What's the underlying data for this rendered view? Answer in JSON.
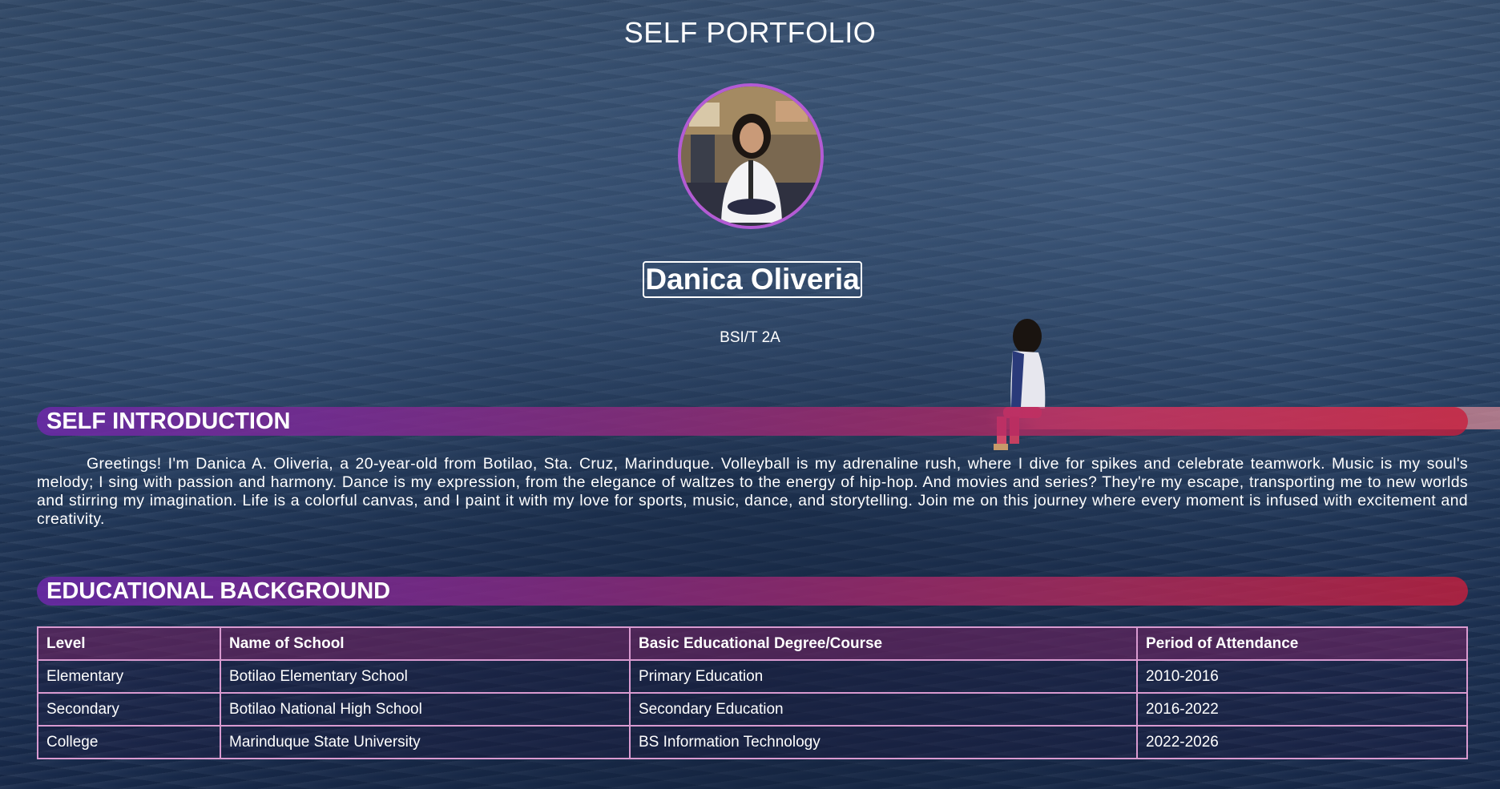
{
  "header": {
    "title": "SELF PORTFOLIO"
  },
  "profile": {
    "name": "Danica Oliveria",
    "course": "BSI/T 2A"
  },
  "intro": {
    "heading": "SELF INTRODUCTION",
    "text": "Greetings! I'm Danica A. Oliveria, a 20-year-old from Botilao, Sta. Cruz, Marinduque. Volleyball is my adrenaline rush, where I dive for spikes and celebrate teamwork. Music is my soul's melody; I sing with passion and harmony. Dance is my expression, from the elegance of waltzes to the energy of hip-hop. And movies and series? They're my escape, transporting me to new worlds and stirring my imagination. Life is a colorful canvas, and I paint it with my love for sports, music, dance, and storytelling. Join me on this journey where every moment is infused with excitement and creativity."
  },
  "education": {
    "heading": "EDUCATIONAL BACKGROUND",
    "columns": [
      "Level",
      "Name of School",
      "Basic Educational Degree/Course",
      "Period of Attendance"
    ],
    "rows": [
      [
        "Elementary",
        "Botilao Elementary School",
        "Primary Education",
        "2010-2016"
      ],
      [
        "Secondary",
        "Botilao National High School",
        "Secondary Education",
        "2016-2022"
      ],
      [
        "College",
        "Marinduque State University",
        "BS Information Technology",
        "2022-2026"
      ]
    ]
  },
  "colors": {
    "avatar_border": "#b35bd4",
    "bar_start": "#6e28aa",
    "bar_end": "#c81e3c",
    "table_border": "#d99ad0"
  },
  "icons": {
    "avatar": "profile-photo"
  }
}
